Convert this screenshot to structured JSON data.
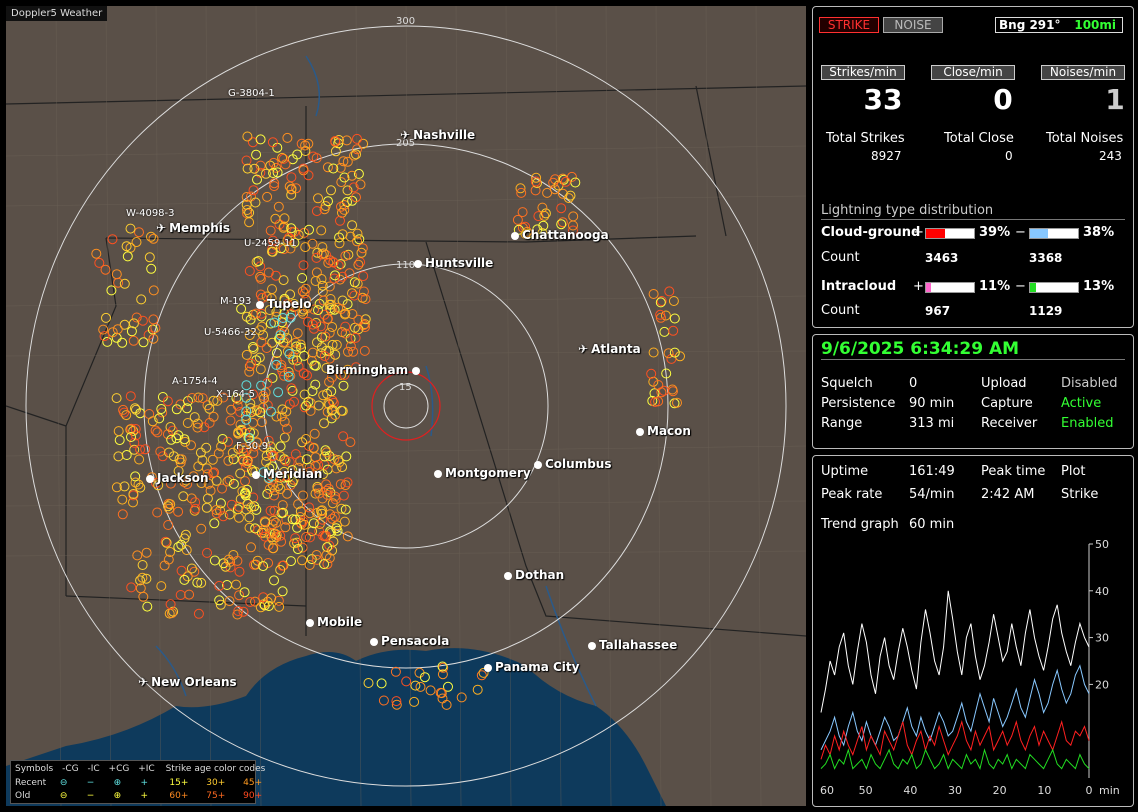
{
  "app": {
    "title": "Doppler5 Weather"
  },
  "map": {
    "range_rings": [
      "300",
      "205",
      "110",
      "15"
    ],
    "cities": [
      {
        "name": "Nashville",
        "kind": "airport"
      },
      {
        "name": "Memphis",
        "kind": "airport"
      },
      {
        "name": "Chattanooga",
        "kind": "city"
      },
      {
        "name": "Huntsville",
        "kind": "city"
      },
      {
        "name": "Tupelo",
        "kind": "city"
      },
      {
        "name": "Atlanta",
        "kind": "airport"
      },
      {
        "name": "Birmingham",
        "kind": "city"
      },
      {
        "name": "Macon",
        "kind": "city"
      },
      {
        "name": "Jackson",
        "kind": "city"
      },
      {
        "name": "Meridian",
        "kind": "city"
      },
      {
        "name": "Montgomery",
        "kind": "city"
      },
      {
        "name": "Columbus",
        "kind": "city"
      },
      {
        "name": "Dothan",
        "kind": "city"
      },
      {
        "name": "Mobile",
        "kind": "city"
      },
      {
        "name": "Pensacola",
        "kind": "city"
      },
      {
        "name": "Tallahassee",
        "kind": "city"
      },
      {
        "name": "Panama City",
        "kind": "city"
      },
      {
        "name": "New Orleans",
        "kind": "airport"
      }
    ],
    "storm_labels": [
      "G-3804-1",
      "W-4098-3",
      "U-2459-11",
      "M-193",
      "U-5466-32",
      "A-1754-4",
      "X-164-5",
      "F-30-9"
    ]
  },
  "legend": {
    "symbols_label": "Symbols",
    "col_headers": [
      "-CG",
      "-IC",
      "+CG",
      "+IC"
    ],
    "age_title": "Strike age color codes",
    "recent_label": "Recent",
    "old_label": "Old",
    "recent_ages": [
      "15+",
      "30+",
      "45+"
    ],
    "old_ages": [
      "60+",
      "75+",
      "90+"
    ],
    "recent_symbols": [
      "⊖",
      "−",
      "⊕",
      "+"
    ],
    "old_symbols": [
      "⊖",
      "−",
      "⊕",
      "+"
    ]
  },
  "panel_top": {
    "strike_btn": "STRIKE",
    "noise_btn": "NOISE",
    "bearing": "Bng 291°",
    "range_btn": "100mi",
    "rate_headers": [
      "Strikes/min",
      "Close/min",
      "Noises/min"
    ],
    "rates": [
      "33",
      "0",
      "1"
    ],
    "total_labels": [
      "Total Strikes",
      "Total Close",
      "Total Noises"
    ],
    "totals": [
      "8927",
      "0",
      "243"
    ],
    "dist_title": "Lightning type distribution",
    "cloud_ground": "Cloud-ground",
    "intracloud": "Intracloud",
    "count_label": "Count",
    "plus": "+",
    "minus": "−",
    "cg_pos_pct": "39%",
    "cg_neg_pct": "38%",
    "ic_pos_pct": "11%",
    "ic_neg_pct": "13%",
    "cg_pos_count": "3463",
    "cg_neg_count": "3368",
    "ic_pos_count": "967",
    "ic_neg_count": "1129",
    "cg_pos_frac": 0.39,
    "cg_neg_frac": 0.38,
    "ic_pos_frac": 0.11,
    "ic_neg_frac": 0.13,
    "colors": {
      "cg_pos": "#ff0000",
      "cg_neg": "#88c8ff",
      "ic_pos": "#ff66cc",
      "ic_neg": "#22dd22"
    }
  },
  "panel_status": {
    "timestamp": "9/6/2025 6:34:29 AM",
    "rows": [
      {
        "k1": "Squelch",
        "v1": "0",
        "k2": "Upload",
        "v2": "Disabled"
      },
      {
        "k1": "Persistence",
        "v1": "90 min",
        "k2": "Capture",
        "v2": "Active"
      },
      {
        "k1": "Range",
        "v1": "313 mi",
        "k2": "Receiver",
        "v2": "Enabled"
      }
    ]
  },
  "panel_trend": {
    "uptime_label": "Uptime",
    "uptime": "161:49",
    "peak_time_label": "Peak time",
    "plot_label": "Plot",
    "peak_rate_label": "Peak rate",
    "peak_rate": "54/min",
    "peak_time": "2:42 AM",
    "plot": "Strike",
    "trend_label": "Trend graph",
    "trend_window": "60 min"
  },
  "chart_data": {
    "type": "line",
    "xlabel": "min",
    "x_ticks": [
      "60",
      "50",
      "40",
      "30",
      "20",
      "10",
      "0"
    ],
    "y_ticks": [
      "50",
      "40",
      "30",
      "20"
    ],
    "ylim": [
      0,
      50
    ],
    "xlim": [
      60,
      0
    ],
    "series": [
      {
        "color": "#ffffff",
        "values": [
          14,
          19,
          25,
          22,
          28,
          31,
          24,
          20,
          27,
          33,
          29,
          22,
          18,
          26,
          30,
          24,
          21,
          27,
          32,
          28,
          23,
          19,
          29,
          36,
          31,
          25,
          22,
          28,
          40,
          34,
          27,
          22,
          30,
          33,
          26,
          21,
          24,
          29,
          35,
          30,
          25,
          27,
          33,
          28,
          24,
          31,
          36,
          30,
          26,
          23,
          28,
          34,
          37,
          31,
          27,
          24,
          29,
          33,
          30,
          28
        ]
      },
      {
        "color": "#88c8ff",
        "values": [
          6,
          8,
          10,
          13,
          9,
          7,
          11,
          14,
          10,
          8,
          12,
          9,
          7,
          10,
          13,
          11,
          8,
          9,
          12,
          15,
          11,
          9,
          13,
          10,
          8,
          11,
          14,
          12,
          9,
          10,
          13,
          16,
          12,
          10,
          14,
          18,
          15,
          12,
          17,
          14,
          11,
          13,
          16,
          19,
          15,
          13,
          17,
          21,
          18,
          14,
          16,
          20,
          23,
          19,
          16,
          18,
          22,
          24,
          20,
          18
        ]
      },
      {
        "color": "#ff2020",
        "values": [
          4,
          7,
          5,
          9,
          6,
          10,
          7,
          5,
          8,
          11,
          6,
          9,
          7,
          5,
          10,
          8,
          6,
          9,
          12,
          7,
          5,
          8,
          10,
          6,
          9,
          7,
          11,
          8,
          5,
          7,
          9,
          12,
          8,
          6,
          10,
          7,
          9,
          11,
          6,
          8,
          10,
          7,
          9,
          12,
          8,
          6,
          9,
          11,
          7,
          10,
          8,
          6,
          9,
          12,
          8,
          7,
          10,
          9,
          11,
          8
        ]
      },
      {
        "color": "#22dd22",
        "values": [
          2,
          3,
          5,
          2,
          4,
          3,
          6,
          2,
          3,
          4,
          2,
          5,
          3,
          2,
          4,
          6,
          3,
          2,
          4,
          3,
          5,
          2,
          3,
          6,
          4,
          2,
          3,
          5,
          2,
          4,
          3,
          2,
          5,
          3,
          4,
          2,
          6,
          3,
          2,
          4,
          3,
          5,
          2,
          4,
          3,
          2,
          5,
          4,
          3,
          2,
          4,
          6,
          3,
          2,
          4,
          3,
          2,
          5,
          3,
          2
        ]
      }
    ]
  }
}
